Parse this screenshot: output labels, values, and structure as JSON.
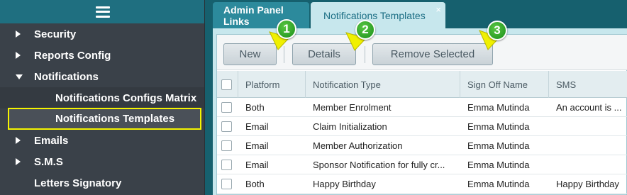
{
  "sidebar": {
    "items": [
      {
        "label": "Security"
      },
      {
        "label": "Reports Config"
      },
      {
        "label": "Notifications"
      },
      {
        "label": "Notifications Configs Matrix"
      },
      {
        "label": "Notifications Templates"
      },
      {
        "label": "Emails"
      },
      {
        "label": "S.M.S"
      },
      {
        "label": "Letters Signatory"
      }
    ]
  },
  "tabs": [
    {
      "label": "Admin Panel Links"
    },
    {
      "label": "Notifications Templates",
      "close": "×"
    }
  ],
  "toolbar": {
    "new_label": "New",
    "details_label": "Details",
    "remove_label": "Remove Selected"
  },
  "callouts": [
    "1",
    "2",
    "3"
  ],
  "table": {
    "columns": [
      "Platform",
      "Notification Type",
      "Sign Off Name",
      "SMS"
    ],
    "rows": [
      {
        "platform": "Both",
        "type": "Member Enrolment",
        "signoff": "Emma Mutinda",
        "sms": "An account is ..."
      },
      {
        "platform": "Email",
        "type": "Claim Initialization",
        "signoff": "Emma Mutinda",
        "sms": ""
      },
      {
        "platform": "Email",
        "type": "Member Authorization",
        "signoff": "Emma Mutinda",
        "sms": ""
      },
      {
        "platform": "Email",
        "type": "Sponsor Notification for fully cr...",
        "signoff": "Emma Mutinda",
        "sms": ""
      },
      {
        "platform": "Both",
        "type": "Happy Birthday",
        "signoff": "Emma Mutinda",
        "sms": "Happy Birthday"
      }
    ]
  },
  "colors": {
    "sidebar_bg": "#3a4149",
    "header_teal": "#1f6f80",
    "highlight_yellow": "#f5f400",
    "tab_active_bg": "#c7e7ed",
    "callout_green": "#2eaa2a"
  }
}
